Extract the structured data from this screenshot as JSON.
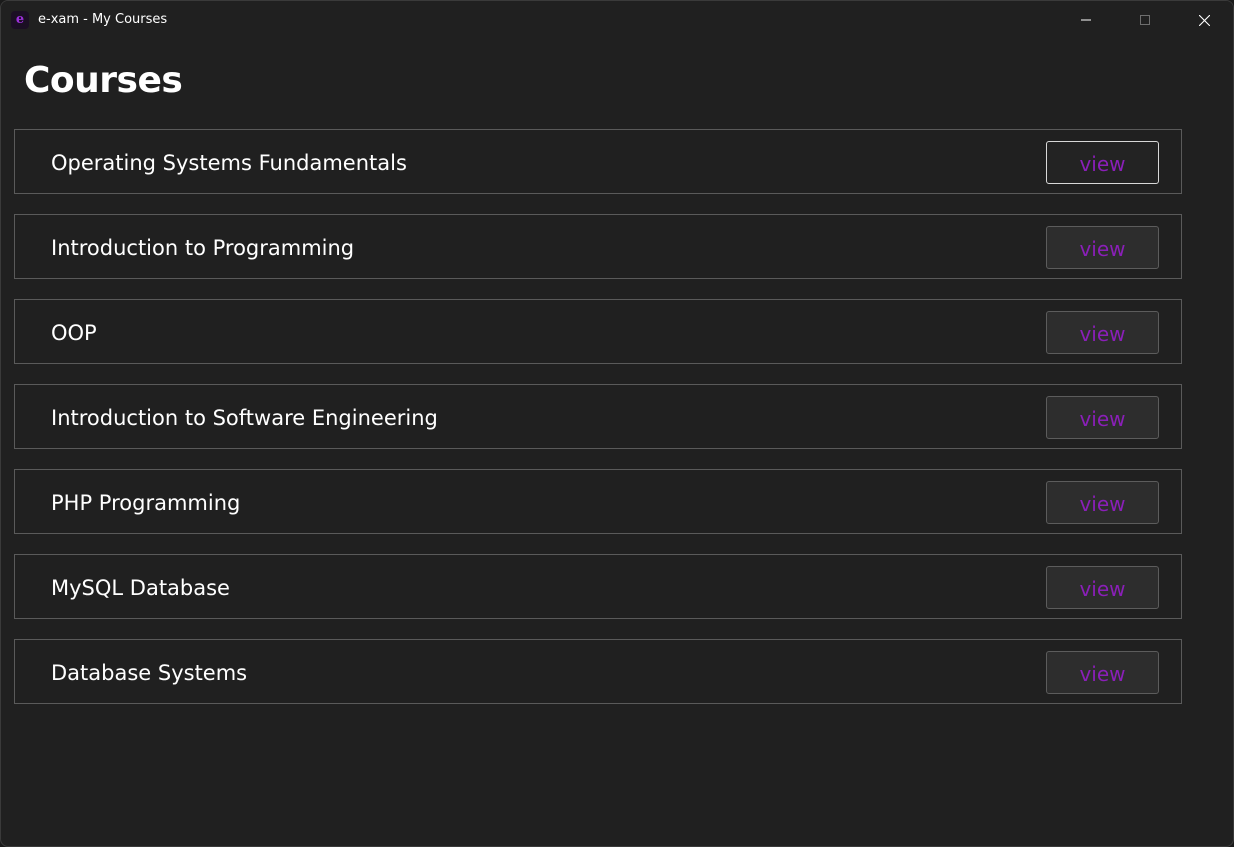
{
  "window": {
    "title": "e-xam - My Courses",
    "app_icon_glyph": "e",
    "app_icon_name": "exam-app-icon",
    "controls": [
      "minimize-icon",
      "maximize-icon",
      "close-icon"
    ]
  },
  "page": {
    "title": "Courses"
  },
  "courses": [
    {
      "name": "Operating Systems Fundamentals",
      "action": "view"
    },
    {
      "name": "Introduction to Programming",
      "action": "view"
    },
    {
      "name": "OOP",
      "action": "view"
    },
    {
      "name": "Introduction to Software Engineering",
      "action": "view"
    },
    {
      "name": "PHP Programming",
      "action": "view"
    },
    {
      "name": "MySQL Database",
      "action": "view"
    },
    {
      "name": "Database Systems",
      "action": "view"
    }
  ],
  "colors": {
    "background": "#202020",
    "text": "#ffffff",
    "accent": "#8a1fb8",
    "row_border": "#5a5a5a",
    "button_bg": "#2d2d2d"
  }
}
